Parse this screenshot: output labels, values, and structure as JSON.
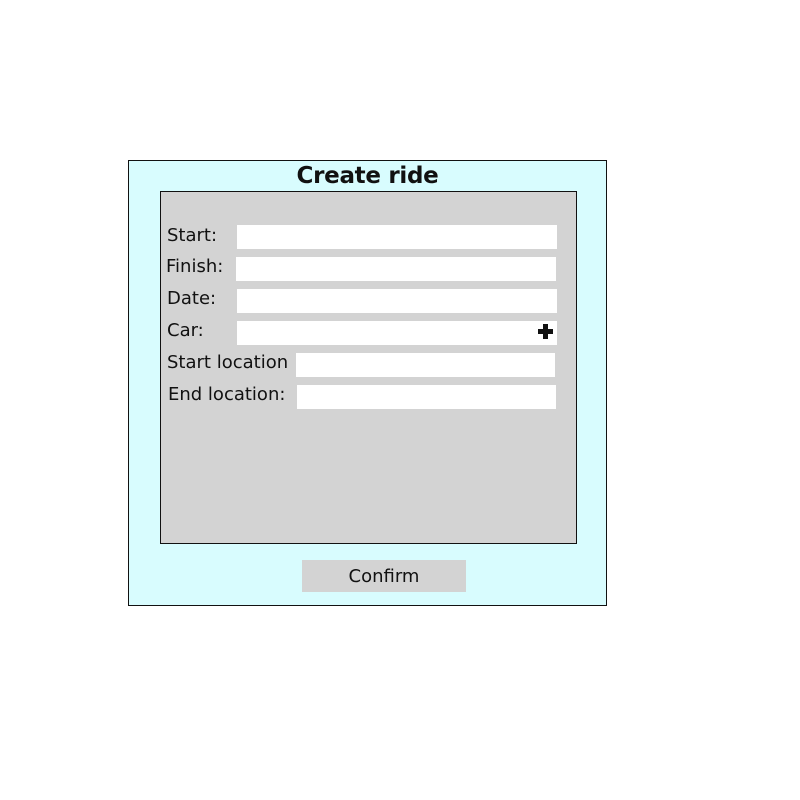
{
  "dialog": {
    "title": "Create ride",
    "fields": {
      "start": {
        "label": "Start:",
        "value": ""
      },
      "finish": {
        "label": "Finish:",
        "value": ""
      },
      "date": {
        "label": "Date:",
        "value": ""
      },
      "car": {
        "label": "Car:",
        "value": "",
        "add_icon": "plus-icon"
      },
      "start_location": {
        "label": "Start location",
        "value": ""
      },
      "end_location": {
        "label": "End location:",
        "value": ""
      }
    },
    "confirm_label": "Confirm"
  },
  "colors": {
    "dialog_background": "#d8fcfe",
    "panel_background": "#d3d3d3",
    "button_background": "#d3d3d3"
  }
}
